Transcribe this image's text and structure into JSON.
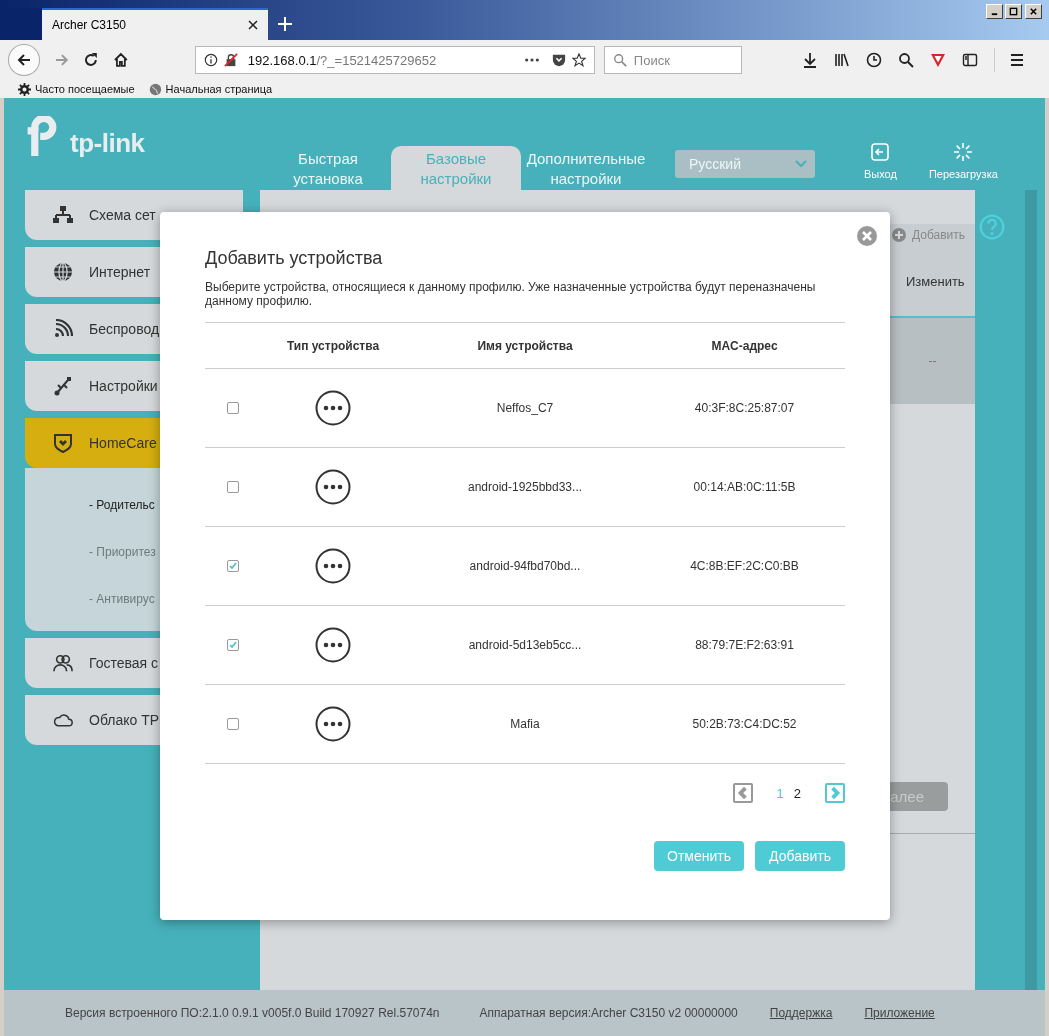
{
  "browser": {
    "tab_title": "Archer C3150",
    "url_host": "192.168.0.1",
    "url_path": "/?_=1521425729652",
    "search_placeholder": "Поиск",
    "bookmarks": [
      {
        "label": "Часто посещаемые",
        "kind": "gear"
      },
      {
        "label": "Начальная страница",
        "kind": "globe"
      }
    ]
  },
  "brand": "tp-link",
  "header": {
    "tabs": [
      {
        "label": "Быстрая установка",
        "selected": false
      },
      {
        "label": "Базовые настройки",
        "selected": true
      },
      {
        "label": "Дополнительные настройки",
        "selected": false
      }
    ],
    "language": "Русский",
    "actions": [
      {
        "label": "Выход",
        "kind": "logout"
      },
      {
        "label": "Перезагрузка",
        "kind": "reboot"
      }
    ]
  },
  "sidebar": {
    "items": [
      {
        "label": "Схема сет",
        "kind": "network",
        "selected": false
      },
      {
        "label": "Интернет",
        "kind": "globe",
        "selected": false
      },
      {
        "label": "Беспровод",
        "kind": "wireless",
        "selected": false
      },
      {
        "label": "Настройки",
        "kind": "usb",
        "selected": false
      },
      {
        "label": "HomeCare",
        "kind": "shield",
        "selected": true,
        "children": [
          {
            "label": "- Родительс",
            "selected": true
          },
          {
            "label": "- Приоритез",
            "selected": false
          },
          {
            "label": "- Антивирус",
            "selected": false
          }
        ]
      },
      {
        "label": "Гостевая с",
        "kind": "users",
        "selected": false
      },
      {
        "label": "Облако TP",
        "kind": "cloud",
        "selected": false
      }
    ]
  },
  "background": {
    "add_button": "Добавить",
    "column": "Изменить",
    "cell": "--",
    "next_button": "алее"
  },
  "dialog": {
    "title": "Добавить устройства",
    "description": "Выберите устройства, относящиеся к данному профилю. Уже назначенные устройства будут переназначены данному профилю.",
    "columns": [
      "Тип устройства",
      "Имя устройства",
      "MAC-адрес"
    ],
    "rows": [
      {
        "checked": false,
        "name": "Neffos_C7",
        "mac": "40:3F:8C:25:87:07"
      },
      {
        "checked": false,
        "name": "android-1925bbd33...",
        "mac": "00:14:AB:0C:11:5B"
      },
      {
        "checked": true,
        "name": "android-94fbd70bd...",
        "mac": "4C:8B:EF:2C:C0:BB"
      },
      {
        "checked": true,
        "name": "android-5d13eb5cc...",
        "mac": "88:79:7E:F2:63:91"
      },
      {
        "checked": false,
        "name": "Mafia",
        "mac": "50:2B:73:C4:DC:52"
      }
    ],
    "pagination": {
      "previous_disabled": true,
      "next_disabled": false,
      "pages": [
        {
          "label": "1",
          "selected": true
        },
        {
          "label": "2",
          "selected": false
        }
      ]
    },
    "buttons": [
      "Отменить",
      "Добавить"
    ]
  },
  "footer": {
    "firmware": "Версия встроенного ПО:2.1.0 0.9.1 v005f.0 Build 170927 Rel.57074n",
    "hardware": "Аппаратная версия:Archer C3150 v2 00000000",
    "links": [
      "Поддержка",
      "Приложение"
    ]
  }
}
